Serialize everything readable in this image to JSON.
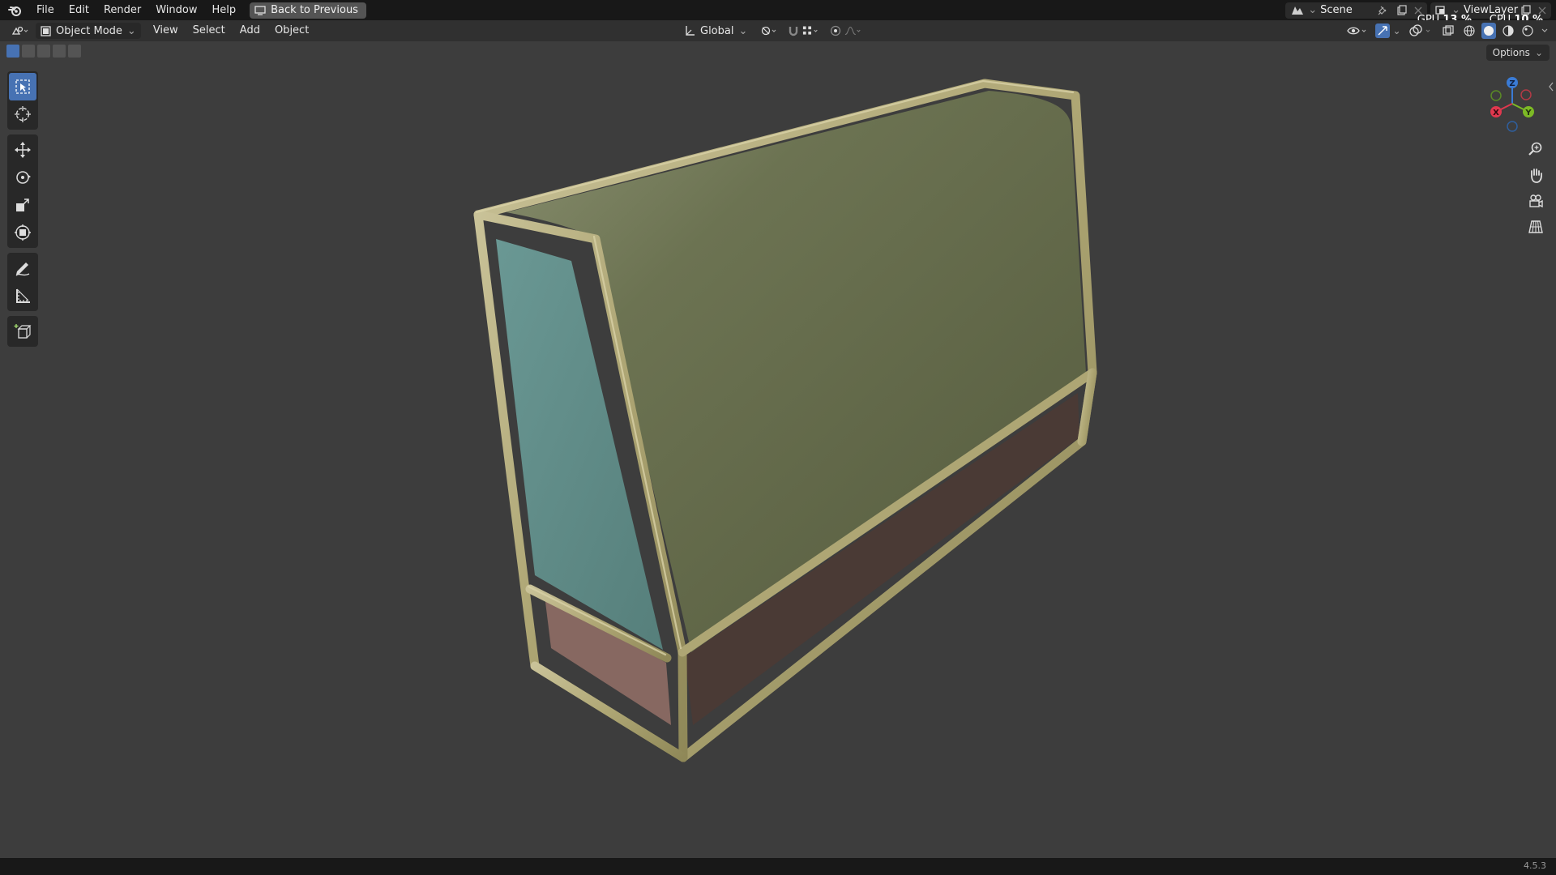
{
  "menubar": {
    "items": [
      "File",
      "Edit",
      "Render",
      "Window",
      "Help"
    ],
    "back_button": "Back to Previous"
  },
  "scene": {
    "name": "Scene"
  },
  "view_layer": {
    "name": "ViewLayer"
  },
  "stats": {
    "gpu_label": "GPU",
    "gpu_value": "13 %",
    "cpu_label": "CPU",
    "cpu_value": "10 %"
  },
  "header": {
    "mode": "Object Mode",
    "items": [
      "View",
      "Select",
      "Add",
      "Object"
    ],
    "orientation": "Global"
  },
  "options_label": "Options",
  "gizmo": {
    "x": "X",
    "y": "Y",
    "z": "Z"
  },
  "status": {
    "version": "4.5.3"
  },
  "colors": {
    "frame": "#b3ac7c",
    "top_panel": "#6e7453",
    "side_window": "#5f8d8a",
    "lower_front": "#876861",
    "lower_back": "#4a3a35",
    "accent": "#4772b3"
  }
}
